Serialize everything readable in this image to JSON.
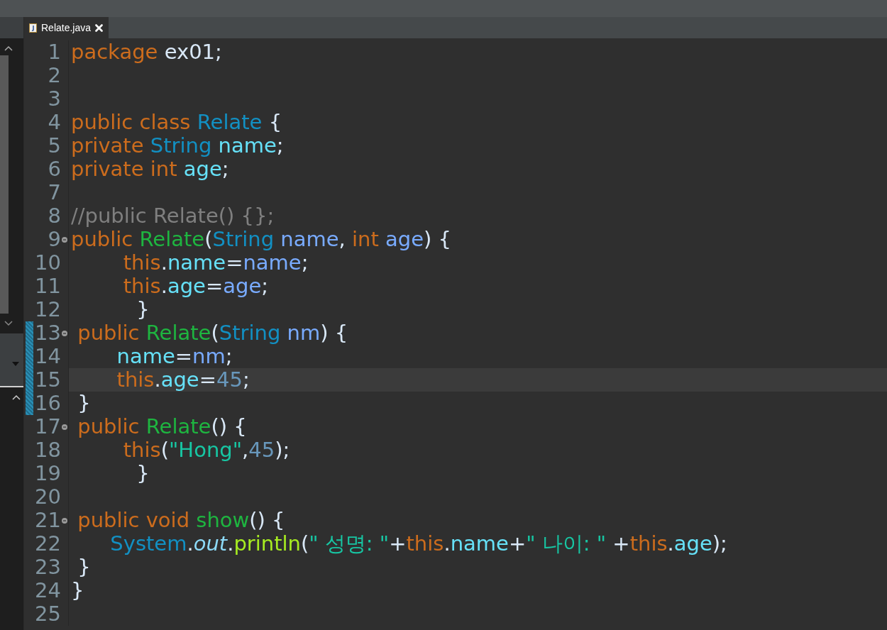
{
  "tab": {
    "title": "Relate.java",
    "selected": true
  },
  "editor": {
    "lines": [
      {
        "number": "1",
        "fold": false,
        "changed": false,
        "current_line": false,
        "tokens": [
          {
            "kind": "keyword",
            "text": "package"
          },
          {
            "kind": "plain",
            "text": " ex01;"
          }
        ]
      },
      {
        "number": "2",
        "fold": false,
        "changed": false,
        "current_line": false
      },
      {
        "number": "3",
        "fold": false,
        "changed": false,
        "current_line": false
      },
      {
        "number": "4",
        "fold": false,
        "changed": false,
        "current_line": false,
        "tokens": [
          {
            "kind": "keyword",
            "text": "public class "
          },
          {
            "kind": "type",
            "text": "Relate"
          },
          {
            "kind": "plain",
            "text": " {"
          }
        ]
      },
      {
        "number": "5",
        "fold": false,
        "changed": false,
        "current_line": false,
        "tokens": [
          {
            "kind": "keyword",
            "text": "private "
          },
          {
            "kind": "type",
            "text": "String "
          },
          {
            "kind": "field",
            "text": "name"
          },
          {
            "kind": "plain",
            "text": ";"
          }
        ]
      },
      {
        "number": "6",
        "fold": false,
        "changed": false,
        "current_line": false,
        "tokens": [
          {
            "kind": "keyword",
            "text": "private int "
          },
          {
            "kind": "field",
            "text": "age"
          },
          {
            "kind": "plain",
            "text": ";"
          }
        ]
      },
      {
        "number": "7",
        "fold": false,
        "changed": false,
        "current_line": false
      },
      {
        "number": "8",
        "fold": false,
        "changed": false,
        "current_line": false,
        "tokens": [
          {
            "kind": "comment",
            "text": "//public Relate() {};"
          }
        ]
      },
      {
        "number": "9",
        "fold": true,
        "changed": false,
        "current_line": false,
        "tokens": [
          {
            "kind": "keyword",
            "text": "public "
          },
          {
            "kind": "method",
            "text": "Relate"
          },
          {
            "kind": "plain",
            "text": "("
          },
          {
            "kind": "type",
            "text": "String "
          },
          {
            "kind": "param",
            "text": "name"
          },
          {
            "kind": "plain",
            "text": ", "
          },
          {
            "kind": "keyword",
            "text": "int "
          },
          {
            "kind": "param",
            "text": "age"
          },
          {
            "kind": "plain",
            "text": ") {"
          }
        ]
      },
      {
        "number": "10",
        "fold": false,
        "changed": false,
        "current_line": false,
        "tokens": [
          {
            "kind": "keyword",
            "text": "        this"
          },
          {
            "kind": "plain",
            "text": "."
          },
          {
            "kind": "field",
            "text": "name"
          },
          {
            "kind": "plain",
            "text": "="
          },
          {
            "kind": "param",
            "text": "name"
          },
          {
            "kind": "plain",
            "text": ";"
          }
        ]
      },
      {
        "number": "11",
        "fold": false,
        "changed": false,
        "current_line": false,
        "tokens": [
          {
            "kind": "keyword",
            "text": "        this"
          },
          {
            "kind": "plain",
            "text": "."
          },
          {
            "kind": "field",
            "text": "age"
          },
          {
            "kind": "plain",
            "text": "="
          },
          {
            "kind": "param",
            "text": "age"
          },
          {
            "kind": "plain",
            "text": ";"
          }
        ]
      },
      {
        "number": "12",
        "fold": false,
        "changed": false,
        "current_line": false,
        "tokens": [
          {
            "kind": "plain",
            "text": "          }"
          }
        ]
      },
      {
        "number": "13",
        "fold": true,
        "changed": true,
        "current_line": false,
        "tokens": [
          {
            "kind": "keyword",
            "text": " public "
          },
          {
            "kind": "method",
            "text": "Relate"
          },
          {
            "kind": "plain",
            "text": "("
          },
          {
            "kind": "type",
            "text": "String "
          },
          {
            "kind": "param",
            "text": "nm"
          },
          {
            "kind": "plain",
            "text": ") {"
          }
        ]
      },
      {
        "number": "14",
        "fold": false,
        "changed": true,
        "current_line": false,
        "tokens": [
          {
            "kind": "field",
            "text": "       name"
          },
          {
            "kind": "plain",
            "text": "="
          },
          {
            "kind": "param",
            "text": "nm"
          },
          {
            "kind": "plain",
            "text": ";"
          }
        ]
      },
      {
        "number": "15",
        "fold": false,
        "changed": true,
        "current_line": true,
        "tokens": [
          {
            "kind": "keyword",
            "text": "       this"
          },
          {
            "kind": "plain",
            "text": "."
          },
          {
            "kind": "field",
            "text": "age"
          },
          {
            "kind": "plain",
            "text": "="
          },
          {
            "kind": "number",
            "text": "45"
          },
          {
            "kind": "plain",
            "text": ";"
          }
        ]
      },
      {
        "number": "16",
        "fold": false,
        "changed": true,
        "current_line": false,
        "tokens": [
          {
            "kind": "plain",
            "text": " }"
          }
        ]
      },
      {
        "number": "17",
        "fold": true,
        "changed": false,
        "current_line": false,
        "tokens": [
          {
            "kind": "keyword",
            "text": " public "
          },
          {
            "kind": "method",
            "text": "Relate"
          },
          {
            "kind": "plain",
            "text": "() {"
          }
        ]
      },
      {
        "number": "18",
        "fold": false,
        "changed": false,
        "current_line": false,
        "tokens": [
          {
            "kind": "keyword",
            "text": "        this"
          },
          {
            "kind": "plain",
            "text": "("
          },
          {
            "kind": "string",
            "text": "\"Hong\""
          },
          {
            "kind": "plain",
            "text": ","
          },
          {
            "kind": "number",
            "text": "45"
          },
          {
            "kind": "plain",
            "text": ");"
          }
        ]
      },
      {
        "number": "19",
        "fold": false,
        "changed": false,
        "current_line": false,
        "tokens": [
          {
            "kind": "plain",
            "text": "          }"
          }
        ]
      },
      {
        "number": "20",
        "fold": false,
        "changed": false,
        "current_line": false
      },
      {
        "number": "21",
        "fold": true,
        "changed": false,
        "current_line": false,
        "tokens": [
          {
            "kind": "keyword",
            "text": " public void "
          },
          {
            "kind": "method",
            "text": "show"
          },
          {
            "kind": "plain",
            "text": "() {"
          }
        ]
      },
      {
        "number": "22",
        "fold": false,
        "changed": false,
        "current_line": false,
        "tokens": [
          {
            "kind": "type",
            "text": "      System"
          },
          {
            "kind": "plain",
            "text": "."
          },
          {
            "kind": "static",
            "text": "out"
          },
          {
            "kind": "plain",
            "text": "."
          },
          {
            "kind": "call",
            "text": "println"
          },
          {
            "kind": "plain",
            "text": "("
          },
          {
            "kind": "string",
            "text": "\" 성명: \""
          },
          {
            "kind": "plain",
            "text": "+"
          },
          {
            "kind": "keyword",
            "text": "this"
          },
          {
            "kind": "plain",
            "text": "."
          },
          {
            "kind": "field",
            "text": "name"
          },
          {
            "kind": "plain",
            "text": "+"
          },
          {
            "kind": "string",
            "text": "\" 나이: \""
          },
          {
            "kind": "plain",
            "text": " +"
          },
          {
            "kind": "keyword",
            "text": "this"
          },
          {
            "kind": "plain",
            "text": "."
          },
          {
            "kind": "field",
            "text": "age"
          },
          {
            "kind": "plain",
            "text": ");"
          }
        ]
      },
      {
        "number": "23",
        "fold": false,
        "changed": false,
        "current_line": false,
        "tokens": [
          {
            "kind": "plain",
            "text": " }"
          }
        ]
      },
      {
        "number": "24",
        "fold": false,
        "changed": false,
        "current_line": false,
        "tokens": [
          {
            "kind": "plain",
            "text": "}"
          }
        ]
      },
      {
        "number": "25",
        "fold": false,
        "changed": false,
        "current_line": false
      }
    ]
  }
}
